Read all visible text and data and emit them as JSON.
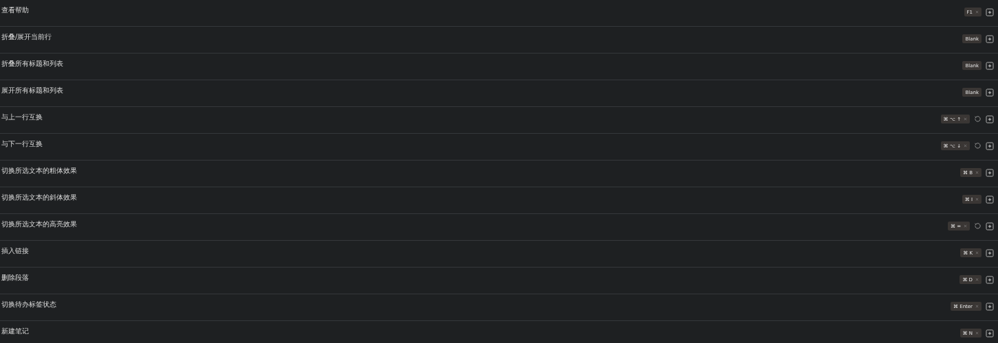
{
  "commands": [
    {
      "label": "查看帮助",
      "hotkey": {
        "kind": "key",
        "text": "F1"
      },
      "customized": false
    },
    {
      "label": "折叠/展开当前行",
      "hotkey": {
        "kind": "blank",
        "text": "Blank"
      },
      "customized": false
    },
    {
      "label": "折叠所有标题和列表",
      "hotkey": {
        "kind": "blank",
        "text": "Blank"
      },
      "customized": false
    },
    {
      "label": "展开所有标题和列表",
      "hotkey": {
        "kind": "blank",
        "text": "Blank"
      },
      "customized": false
    },
    {
      "label": "与上一行互换",
      "hotkey": {
        "kind": "key",
        "text": "⌘ ⌥ ↑"
      },
      "customized": true
    },
    {
      "label": "与下一行互换",
      "hotkey": {
        "kind": "key",
        "text": "⌘ ⌥ ↓"
      },
      "customized": true
    },
    {
      "label": "切换所选文本的粗体效果",
      "hotkey": {
        "kind": "key",
        "text": "⌘ B"
      },
      "customized": false
    },
    {
      "label": "切换所选文本的斜体效果",
      "hotkey": {
        "kind": "key",
        "text": "⌘ I"
      },
      "customized": false
    },
    {
      "label": "切换所选文本的高亮效果",
      "hotkey": {
        "kind": "key",
        "text": "⌘ ="
      },
      "customized": true
    },
    {
      "label": "插入链接",
      "hotkey": {
        "kind": "key",
        "text": "⌘ K"
      },
      "customized": false
    },
    {
      "label": "删除段落",
      "hotkey": {
        "kind": "key",
        "text": "⌘ D"
      },
      "customized": false
    },
    {
      "label": "切换待办标签状态",
      "hotkey": {
        "kind": "key",
        "text": "⌘ Enter"
      },
      "customized": false
    },
    {
      "label": "新建笔记",
      "hotkey": {
        "kind": "key",
        "text": "⌘ N"
      },
      "customized": false
    }
  ]
}
